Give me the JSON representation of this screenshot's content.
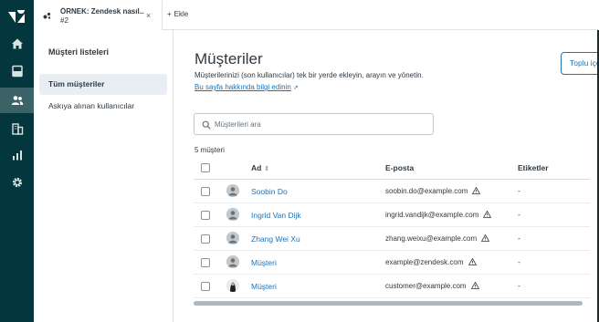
{
  "colors": {
    "rail_bg": "#03363d",
    "accent": "#1f73b7",
    "text": "#2f3941"
  },
  "rail": {
    "items": [
      {
        "icon": "home-icon"
      },
      {
        "icon": "views-icon"
      },
      {
        "icon": "customers-icon",
        "active": true
      },
      {
        "icon": "organizations-icon"
      },
      {
        "icon": "reporting-icon"
      },
      {
        "icon": "admin-gear-icon"
      }
    ]
  },
  "tabs": {
    "active": {
      "title": "ÖRNEK: Zendesk nasıl...",
      "subtitle": "#2",
      "close": "×"
    },
    "add_label": "Ekle",
    "add_plus": "+"
  },
  "sidebar": {
    "title": "Müşteri listeleri",
    "items": [
      {
        "label": "Tüm müşteriler",
        "active": true
      },
      {
        "label": "Askıya alınan kullanıcılar",
        "active": false
      }
    ]
  },
  "main": {
    "title": "Müşteriler",
    "description": "Müşterilerinizi (son kullanıcılar) tek bir yerde ekleyin, arayın ve yönetin.",
    "help_link": "Bu sayfa hakkında bilgi edinin",
    "help_link_icon": "↗",
    "bulk_button": "Toplu içe aktar",
    "search": {
      "placeholder": "Müşterileri ara",
      "value": ""
    },
    "count": "5 müşteri"
  },
  "table": {
    "columns": {
      "name": "Ad",
      "name_sort": "⇕",
      "email": "E-posta",
      "tags": "Etiketler"
    },
    "rows": [
      {
        "name": "Soobin Do",
        "email": "soobin.do@example.com",
        "tags": "-",
        "avatar": "default",
        "warning": true
      },
      {
        "name": "Ingrid Van Dijk",
        "email": "ingrid.vandijk@example.com",
        "tags": "-",
        "avatar": "default",
        "warning": true
      },
      {
        "name": "Zhang Wei Xu",
        "email": "zhang.weixu@example.com",
        "tags": "-",
        "avatar": "default",
        "warning": true
      },
      {
        "name": "Müşteri",
        "email": "example@zendesk.com",
        "tags": "-",
        "avatar": "default",
        "warning": true
      },
      {
        "name": "Müşteri",
        "email": "customer@example.com",
        "tags": "-",
        "avatar": "photo",
        "warning": true
      }
    ]
  }
}
